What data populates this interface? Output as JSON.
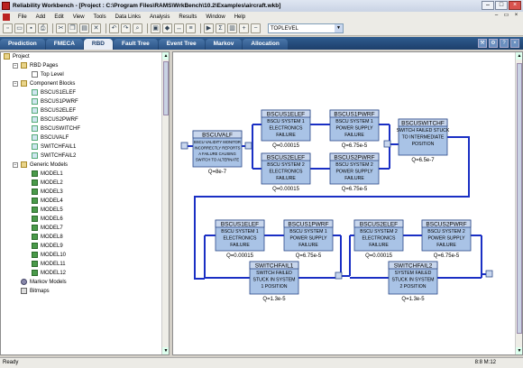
{
  "window": {
    "title": "Reliability Workbench - [Project : C:\\Program Files\\RAMS\\WrkBench\\10.2\\Examples\\aircraft.wkb]"
  },
  "menu": [
    "File",
    "Add",
    "Edit",
    "View",
    "Tools",
    "Data Links",
    "Analysis",
    "Results",
    "Window",
    "Help"
  ],
  "toolbar": {
    "combo_value": "TOPLEVEL"
  },
  "tabs": [
    {
      "label": "Prediction",
      "active": false
    },
    {
      "label": "FMECA",
      "active": false
    },
    {
      "label": "RBD",
      "active": true
    },
    {
      "label": "Fault Tree",
      "active": false
    },
    {
      "label": "Event Tree",
      "active": false
    },
    {
      "label": "Markov",
      "active": false
    },
    {
      "label": "Allocation",
      "active": false
    }
  ],
  "tree": {
    "root": "Project",
    "rbd_pages": "RBD Pages",
    "top_level": "Top Level",
    "component_blocks": "Component Blocks",
    "blocks": [
      "BSCUS1ELEF",
      "BSCUS1PWRF",
      "BSCUS2ELEF",
      "BSCUS2PWRF",
      "BSCUSWITCHF",
      "BSCUVALF",
      "SWITCHFAIL1",
      "SWITCHFAIL2"
    ],
    "generic_models": "Generic Models",
    "models": [
      "MODEL1",
      "MODEL2",
      "MODEL3",
      "MODEL4",
      "MODEL5",
      "MODEL6",
      "MODEL7",
      "MODEL8",
      "MODEL9",
      "MODEL10",
      "MODEL11",
      "MODEL12"
    ],
    "markov_models": "Markov Models",
    "bitmaps": "Bitmaps"
  },
  "diagram": {
    "blocks": [
      {
        "id": "BSCUVALF",
        "desc": [
          "BSCU VALIDITY MONITOR",
          "INCORRECTLY REPORTS",
          "A FAILURE CAUSING",
          "SWITCH TO ALTERNATE"
        ],
        "q": "Q=8e-7"
      },
      {
        "id": "BSCUS1ELEF",
        "desc": [
          "BSCU SYSTEM 1",
          "ELECTRONICS",
          "FAILURE"
        ],
        "q": "Q=0.00015"
      },
      {
        "id": "BSCUS1PWRF",
        "desc": [
          "BSCU SYSTEM 1",
          "POWER SUPPLY",
          "FAILURE"
        ],
        "q": "Q=6.75e-5"
      },
      {
        "id": "BSCUS2ELEF",
        "desc": [
          "BSCU SYSTEM 2",
          "ELECTRONICS",
          "FAILURE"
        ],
        "q": "Q=0.00015"
      },
      {
        "id": "BSCUS2PWRF",
        "desc": [
          "BSCU SYSTEM 2",
          "POWER SUPPLY",
          "FAILURE"
        ],
        "q": "Q=6.75e-5"
      },
      {
        "id": "BSCUSWITCHF",
        "desc": [
          "SWITCH FAILED STUCK",
          "TO INTERMEDIATE",
          "POSITION"
        ],
        "q": "Q=6.5e-7"
      },
      {
        "id": "BSCUS1ELEF",
        "desc": [
          "BSCU SYSTEM 1",
          "ELECTRONICS",
          "FAILURE"
        ],
        "q": "Q=0.00015"
      },
      {
        "id": "BSCUS1PWRF",
        "desc": [
          "BSCU SYSTEM 1",
          "POWER SUPPLY",
          "FAILURE"
        ],
        "q": "Q=6.75e-5"
      },
      {
        "id": "BSCUS2ELEF",
        "desc": [
          "BSCU SYSTEM 2",
          "ELECTRONICS",
          "FAILURE"
        ],
        "q": "Q=0.00015"
      },
      {
        "id": "BSCUS2PWRF",
        "desc": [
          "BSCU SYSTEM 2",
          "POWER SUPPLY",
          "FAILURE"
        ],
        "q": "Q=6.75e-5"
      },
      {
        "id": "SWITCHFAIL1",
        "desc": [
          "SWITCH FAILED",
          "STUCK IN SYSTEM",
          "1 POSITION"
        ],
        "q": "Q=1.3e-5"
      },
      {
        "id": "SWITCHFAIL2",
        "desc": [
          "SYSTEM FAILED",
          "STUCK IN SYSTEM",
          "2 POSITION"
        ],
        "q": "Q=1.3e-5"
      }
    ]
  },
  "status": {
    "left": "Ready",
    "position": "8:8 M:12"
  },
  "colors": {
    "block_header": "#c8d6ec",
    "block_body": "#a9c3e6",
    "block_border": "#2c4a8a",
    "wire": "#1a2fc4"
  }
}
